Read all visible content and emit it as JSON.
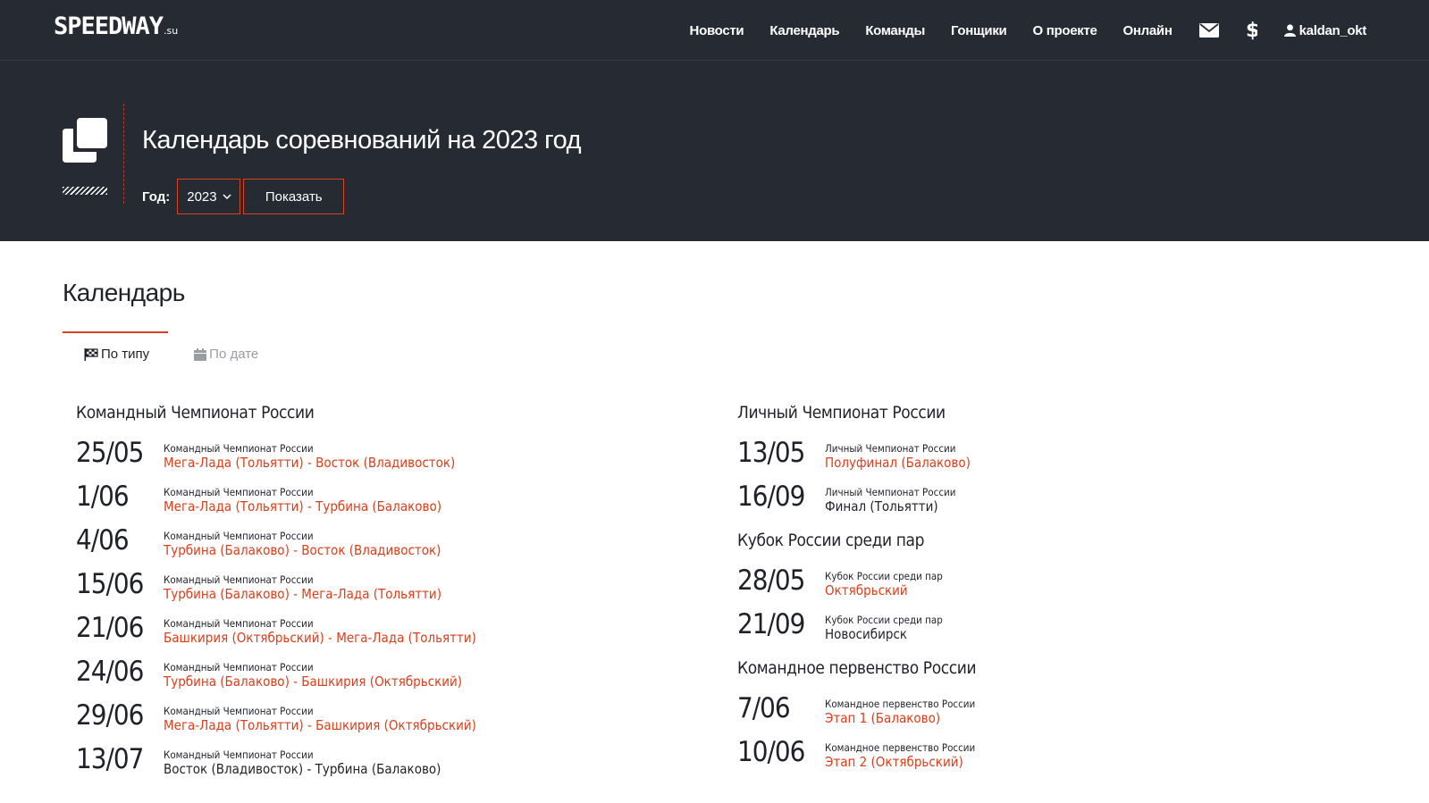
{
  "nav": {
    "logo_main": "SPEEDWAY",
    "logo_domain": ".su",
    "items": [
      "Новости",
      "Календарь",
      "Команды",
      "Гонщики",
      "О проекте",
      "Онлайн"
    ],
    "mail_icon": "envelope-icon",
    "money_icon": "dollar-icon",
    "user": "kaldan_okt"
  },
  "hero": {
    "title": "Календарь соревнований на 2023 год",
    "year_label": "Год:",
    "year_value": "2023",
    "show_button": "Показать"
  },
  "calendar": {
    "title": "Календарь",
    "tabs": {
      "by_type": "По типу",
      "by_date": "По дате"
    },
    "left": {
      "group": "Командный Чемпионат России",
      "events": [
        {
          "date": "25/05",
          "cat": "Командный Чемпионат России",
          "name": "Мега-Лада (Тольятти) - Восток (Владивосток)"
        },
        {
          "date": "1/06",
          "cat": "Командный Чемпионат России",
          "name": "Мега-Лада (Тольятти) - Турбина (Балаково)"
        },
        {
          "date": "4/06",
          "cat": "Командный Чемпионат России",
          "name": "Турбина (Балаково) - Восток (Владивосток)"
        },
        {
          "date": "15/06",
          "cat": "Командный Чемпионат России",
          "name": "Турбина (Балаково) - Мега-Лада (Тольятти)"
        },
        {
          "date": "21/06",
          "cat": "Командный Чемпионат России",
          "name": "Башкирия (Октябрьский) - Мега-Лада (Тольятти)"
        },
        {
          "date": "24/06",
          "cat": "Командный Чемпионат России",
          "name": "Турбина (Балаково) - Башкирия (Октябрьский)"
        },
        {
          "date": "29/06",
          "cat": "Командный Чемпионат России",
          "name": "Мега-Лада (Тольятти) - Башкирия (Октябрьский)"
        },
        {
          "date": "13/07",
          "cat": "Командный Чемпионат России",
          "name": "Восток (Владивосток) - Турбина (Балаково)"
        }
      ]
    },
    "right": {
      "group1": "Личный Чемпионат России",
      "events1": [
        {
          "date": "13/05",
          "cat": "Личный Чемпионат России",
          "name": "Полуфинал (Балаково)"
        },
        {
          "date": "16/09",
          "cat": "Личный Чемпионат России",
          "name": "Финал (Тольятти)"
        }
      ],
      "group2": "Кубок России среди пар",
      "events2": [
        {
          "date": "28/05",
          "cat": "Кубок России среди пар",
          "name": "Октябрьский"
        },
        {
          "date": "21/09",
          "cat": "Кубок России среди пар",
          "name": "Новосибирск"
        }
      ],
      "group3": "Командное первенство России",
      "events3": [
        {
          "date": "7/06",
          "cat": "Командное первенство России",
          "name": "Этап 1 (Балаково)"
        },
        {
          "date": "10/06",
          "cat": "Командное первенство России",
          "name": "Этап 2 (Октябрьский)"
        }
      ]
    }
  },
  "colors": {
    "dark": "#262a33",
    "accent": "#d9401c",
    "text": "#1f2229",
    "muted": "#9a9da3"
  }
}
